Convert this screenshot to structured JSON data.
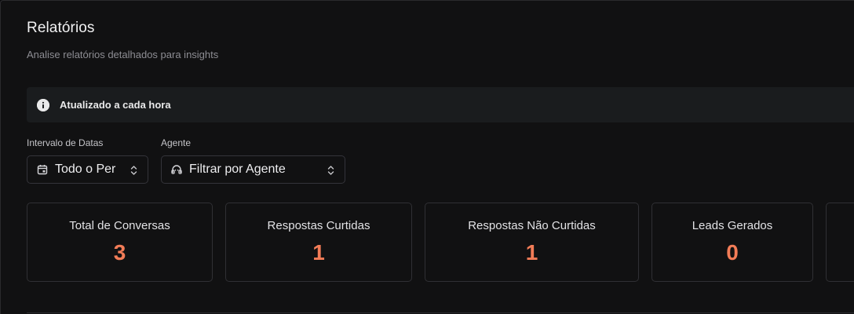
{
  "header": {
    "title": "Relatórios",
    "subtitle": "Analise relatórios detalhados para insights"
  },
  "banner": {
    "icon": "info-icon",
    "text": "Atualizado a cada hora"
  },
  "filters": {
    "date_range": {
      "label": "Intervalo de Datas",
      "value": "Todo o Per",
      "icon": "calendar-icon"
    },
    "agent": {
      "label": "Agente",
      "value": "Filtrar por Agente",
      "icon": "agent-icon"
    }
  },
  "stats": [
    {
      "label": "Total de Conversas",
      "value": "3"
    },
    {
      "label": "Respostas Curtidas",
      "value": "1"
    },
    {
      "label": "Respostas Não Curtidas",
      "value": "1"
    },
    {
      "label": "Leads Gerados",
      "value": "0"
    }
  ],
  "colors": {
    "accent": "#f27c57",
    "background": "#111112",
    "border": "#303034"
  }
}
